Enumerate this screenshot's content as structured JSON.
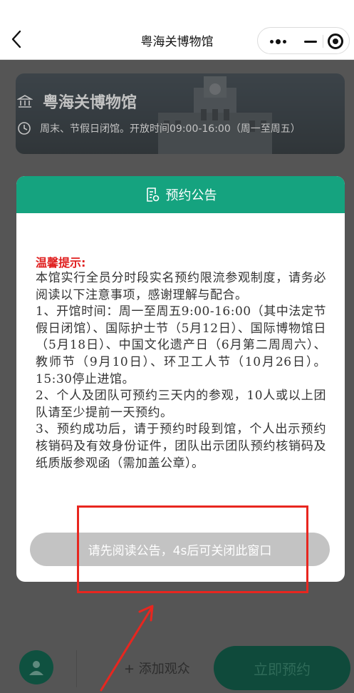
{
  "nav": {
    "title": "粤海关博物馆"
  },
  "banner": {
    "museum_name": "粤海关博物馆",
    "hours_text": "周末、节假日闭馆。开放时间09:00-16:00（周一至周五）"
  },
  "modal": {
    "title": "预约公告",
    "warm_tip": "温馨提示:",
    "paragraphs": [
      "本馆实行全员分时段实名预约限流参观制度，请务必阅读以下注意事项，感谢理解与配合。",
      "1、开馆时间：周一至周五9:00-16:00（其中法定节假日闭馆）、国际护士节（5月12日）、国际博物馆日（5月18日）、中国文化遗产日（6月第二周周六）、教师节（9月10日）、环卫工人节（10月26日）。15:30停止进馆。",
      "2、个人及团队可预约三天内的参观，10人或以上团队请至少提前一天预约。",
      "3、预约成功后，请于预约时段到馆，个人出示预约核销码及有效身份证件，团队出示团队预约核销码及纸质版参观函（需加盖公章）。"
    ],
    "close_button_label": "请先阅读公告，4s后可关闭此窗口"
  },
  "bottom": {
    "add_visitor_label": "+ 添加观众",
    "reserve_label": "立即预约"
  },
  "colors": {
    "accent_green": "#15a37f",
    "annotation_red": "#e8261f",
    "warm_tip_red": "#e02020"
  }
}
